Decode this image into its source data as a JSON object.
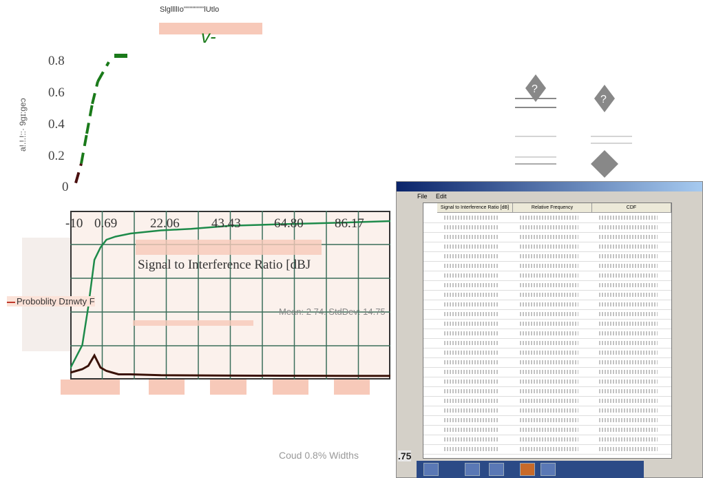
{
  "chart_data": {
    "type": "line",
    "title": "SlgllllIo''''''''''''''lUtlo",
    "ylabel": "a!.!.!::· 9ɡɪ:ɡeɔ",
    "yticks": [
      "0",
      "0.2",
      "0.4",
      "0.6",
      "0.8"
    ],
    "xticks": [
      "-10",
      "0.69",
      "22.06",
      "43.43",
      "64.80",
      "86.17"
    ],
    "xlabel": "Signal to Interference Ratio [dBJ",
    "legend": "Proboblity Dɪnwty  F",
    "stats": "Mean: 2 74. StdDev: 14.75",
    "ylim": [
      0,
      0.9
    ],
    "series": [
      {
        "x": [
          0.0,
          0.05,
          0.1,
          0.15,
          0.2,
          0.3
        ],
        "y": [
          0.02,
          0.15,
          0.35,
          0.55,
          0.7,
          0.83
        ]
      }
    ],
    "cdf_series": {
      "x": [
        -10,
        -6,
        -4,
        -2,
        0,
        2,
        5,
        10,
        20,
        30,
        43,
        60,
        80,
        96
      ],
      "y": [
        0.05,
        0.2,
        0.45,
        0.75,
        0.83,
        0.88,
        0.9,
        0.92,
        0.94,
        0.95,
        0.97,
        0.98,
        0.99,
        1.0
      ]
    },
    "pdf_series": {
      "x": [
        -10,
        -8,
        -6,
        -4,
        -2,
        0,
        2,
        4,
        6,
        10,
        20,
        40,
        60,
        96
      ],
      "y": [
        0.02,
        0.03,
        0.04,
        0.06,
        0.12,
        0.05,
        0.03,
        0.02,
        0.01,
        0.01,
        0.005,
        0.003,
        0.002,
        0.001
      ]
    },
    "grid": true
  },
  "window": {
    "menu": [
      "File",
      "Edit"
    ],
    "columns": [
      "Signal to Interference Ratio [dB]",
      "Relative Frequency",
      "CDF"
    ]
  },
  "footer": {
    "faded": "Coud 0.8% Widths",
    "value": ".75"
  },
  "colors": {
    "accent": "#1a7a1a",
    "dark": "#4a1010",
    "legend": "#c0392b"
  }
}
